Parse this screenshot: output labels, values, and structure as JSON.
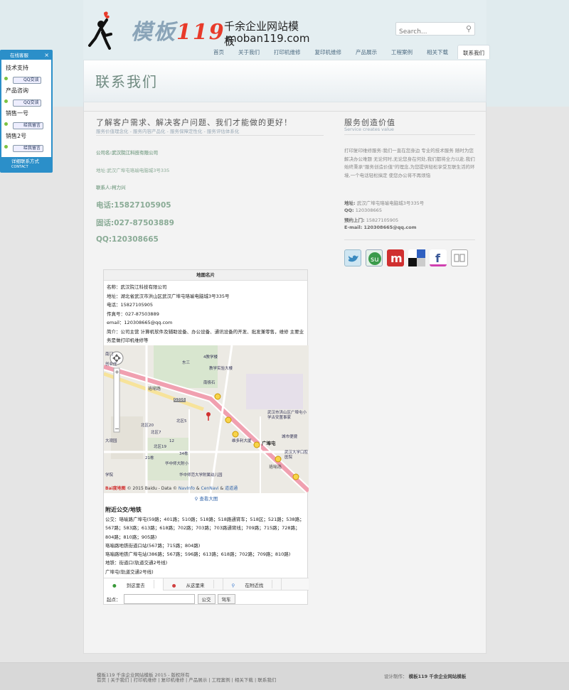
{
  "site": {
    "logo_mark": "模板",
    "logo_number": "119",
    "tagline_1": "千余企业网站模板",
    "tagline_2": "moban119.com"
  },
  "search": {
    "placeholder": "Search..."
  },
  "nav": [
    "首页",
    "关于我们",
    "打印机维修",
    "复印机维修",
    "产品展示",
    "工程案例",
    "相关下载",
    "联系我们"
  ],
  "nav_active": "联系我们",
  "banner_title": "联系我们",
  "main": {
    "heading": "了解客户需求、解决客户问题、我们才能做的更好！",
    "subheading": "服务价值理念化 - 服务内容产品化 - 服务保障定性化 - 服务评估体系化",
    "company": "公司名:武汉院江科技有限公司",
    "address": "地址:武汉广埠屯珞瑜电脑城3号335",
    "contact": "联系人:柯力兴",
    "phone": "电话:15827105905",
    "tel": "固话:027-87503889",
    "qq": "QQ:120308665"
  },
  "sidebar": {
    "heading": "服务创造价值",
    "subheading": "Service creates value",
    "paragraph": "打印复印维修服务:我们一直在您身边 专业的技术服务 随时为您解决办公难题 无论何时,无论您身在何处,我们都将全力以赴.我们始终秉承\"服务创造价值\"的理念,为您提供轻松享受互联生活的环境,一个电话轻松搞定 使您办公将不再烦恼",
    "addr_label": "地址:",
    "addr": "武汉广埠屯珞瑜电脑城3号335号",
    "qq_label": "QQ:",
    "qq": "120308665",
    "appt_label": "预约上门:",
    "appt": "15827105905",
    "email_label": "E-mail:",
    "email": "120308665@qq.com"
  },
  "social_icons": [
    "twitter-icon",
    "stumbleupon-icon",
    "mixx-icon",
    "delicious-icon",
    "facebook-icon",
    "digg-icon"
  ],
  "map_card": {
    "title": "地图名片",
    "name": "名称：武汉院江科技有限公司",
    "address": "地址：湖北省武汉市洪山区武汉广埠屯珞瑜电脑城3号335号",
    "phone": "电话：15827105905",
    "fax": "传真号：027-87503889",
    "email": "email：120308665@qq.com",
    "intro": "简介：公司主营 计算机软件及辅助设备、办公设备、通讯设备的开发、批发兼零售，维修 主要业务是做打印机维修等",
    "map_labels": {
      "broadcast": "广埠屯",
      "district": "武汉市洪山区广埠屯小学古安置事家",
      "road1": "珞喻路",
      "road2": "珞喻路",
      "g316": "G316",
      "nanjiao": "南极石",
      "jiaoxue": "4教学楼",
      "shiyan": "教学实验大楼",
      "chengshi": "城市便捷",
      "daxue": "武汉大学口腔医院",
      "weiduo": "维多利大厦",
      "dongsan": "东三",
      "beiyi": "北区5",
      "zhongshi": "华中师大附小",
      "youer": "华中师范大学附属幼儿园",
      "bei20": "北区20",
      "bei19": "北区19",
      "d21": "21栋",
      "d12": "12",
      "d34": "34栋",
      "bei7": "北区7",
      "daguanyuan": "大观园",
      "chuangyezhuang": "创业庄",
      "nanmen": "南门",
      "xueyuan": "学院"
    },
    "map_copyright": "© 2015 Baidu - Data ©",
    "map_navinfo": "NavInfo",
    "map_amp": "&",
    "map_cennavi": "CenNavi",
    "map_amp2": "&",
    "map_daodao": "道道通",
    "baidu_logo": "Bai度地图",
    "view_larger": "查看大图",
    "bus_title": "附近公交/地铁",
    "bus_lines": [
      "公交：珞喻路广埠屯(59路；401路；510路；518路；518路通宵车；518区；521路；538路；567路；583路；613路；618路；702路；703路；703路通宵线；709路；715路；728路；804路；810路；905路)",
      "珞喻路地铁街道口站(567路；715路；804路)",
      "珞喻路地铁广埠屯站(386路；567路；596路；613路；618路；702路；709路；810路)",
      "地铁：街道口(轨道交通2号线)",
      "广埠屯(轨道交通2号线)"
    ],
    "tab_to": "到这里去",
    "tab_from": "从这里来",
    "tab_near": "在附近找",
    "start_label": "起点：",
    "btn_bus": "公交",
    "btn_car": "驾车"
  },
  "footer": {
    "copyright": "模板119 千余企业网站模板 2015 - 版权所有",
    "links": "首页 | 关于我们 | 打印机维修 | 复印机维修 | 产品展示 | 工程案例 | 相关下载 | 联系我们",
    "design_label": "设计制作：",
    "design_by": "模板119 千余企业网站模板"
  },
  "qq_widget": {
    "title": "在线客服",
    "close": "×",
    "groups": [
      "技术支持",
      "产品咨询",
      "销售一号",
      "销售2号"
    ],
    "qq_btn": "QQ交谈",
    "msg_btn": "给我留言",
    "footer_1": "详细联系方式",
    "footer_2": "CONTACT"
  }
}
